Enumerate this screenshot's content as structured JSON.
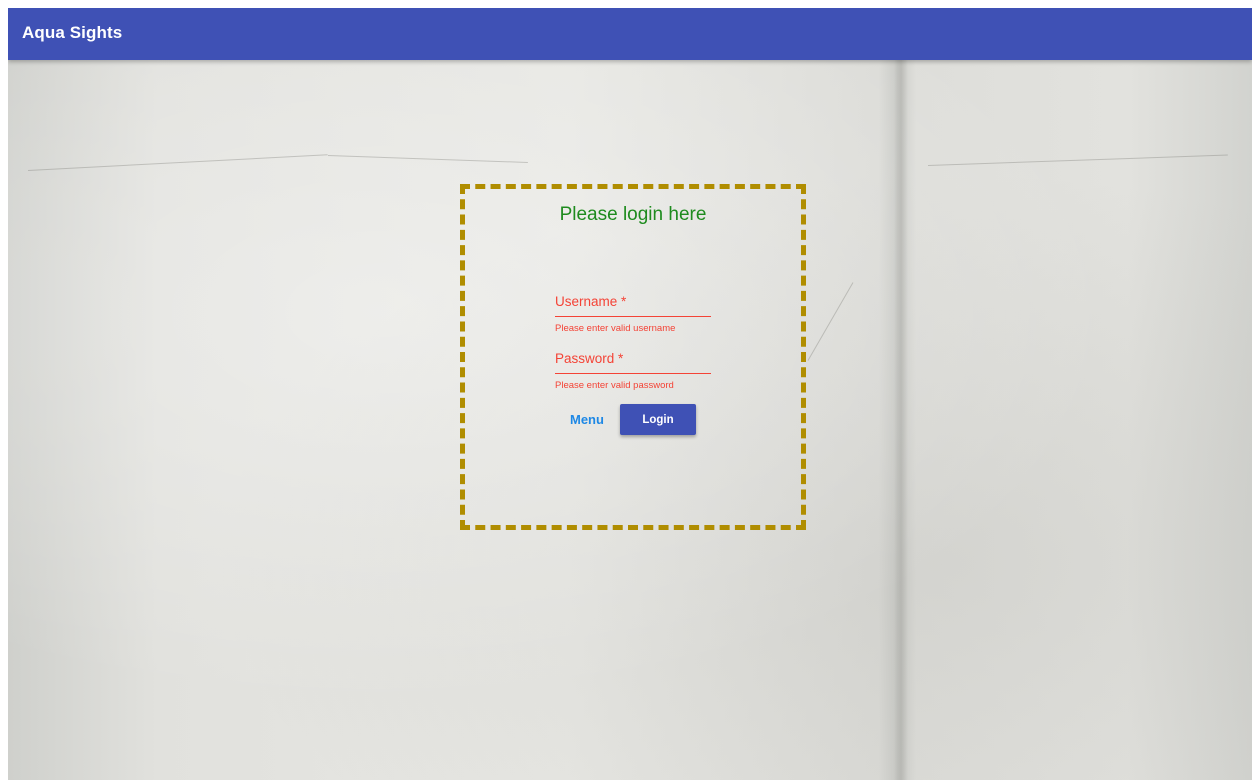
{
  "app": {
    "title": "Aqua Sights"
  },
  "login": {
    "heading": "Please login here",
    "username": {
      "label": "Username *",
      "value": "",
      "error": "Please enter valid username"
    },
    "password": {
      "label": "Password *",
      "value": "",
      "error": "Please enter valid password"
    },
    "menu_label": "Menu",
    "login_label": "Login"
  },
  "colors": {
    "toolbar": "#3f51b5",
    "heading": "#1e8b1e",
    "error": "#f44336",
    "menu_link": "#1e88e5",
    "login_button": "#3f51b5",
    "box_border": "#b08d00"
  }
}
